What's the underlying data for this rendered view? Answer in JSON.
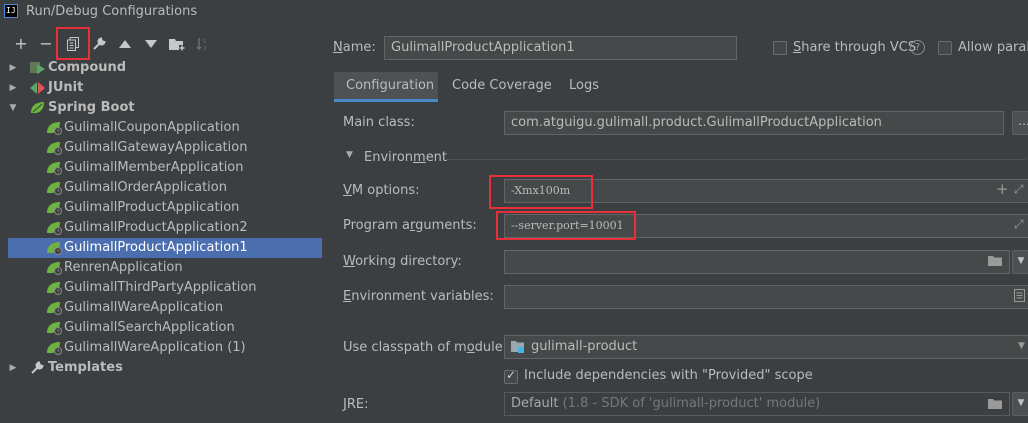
{
  "window": {
    "title": "Run/Debug Configurations",
    "app_icon": "IJ"
  },
  "toolbar": {
    "buttons": [
      "add-icon",
      "remove-icon",
      "copy-icon",
      "wrench-icon",
      "move-up-icon",
      "move-down-icon",
      "new-folder-icon",
      "sort-icon"
    ]
  },
  "tree": {
    "groups": {
      "compound": "Compound",
      "junit": "JUnit",
      "spring_boot": "Spring Boot",
      "templates": "Templates"
    },
    "items": [
      "GulimallCouponApplication",
      "GulimallGatewayApplication",
      "GulimallMemberApplication",
      "GulimallOrderApplication",
      "GulimallProductApplication",
      "GulimallProductApplication2",
      "GulimallProductApplication1",
      "RenrenApplication",
      "GulimallThirdPartyApplication",
      "GulimallWareApplication",
      "GulimallSearchApplication",
      "GulimallWareApplication (1)"
    ],
    "selected_index": 6
  },
  "form": {
    "name_label": "Name:",
    "name_value": "GulimallProductApplication1",
    "share_label": "Share through VCS",
    "share_checked": false,
    "allow_parallel_label": "Allow paral",
    "allow_parallel_checked": false,
    "tabs": [
      "Configuration",
      "Code Coverage",
      "Logs"
    ],
    "active_tab": "Configuration",
    "main_class_label": "Main class:",
    "main_class_value": "com.atguigu.gulimall.product.GulimallProductApplication",
    "browse_label": "...",
    "environment_label": "Environment",
    "vm_options_label": "VM options:",
    "vm_options_value": "-Xmx100m",
    "program_args_label": "Program arguments:",
    "program_args_value": "--server.port=10001",
    "working_dir_label": "Working directory:",
    "working_dir_value": "",
    "env_vars_label": "Environment variables:",
    "env_vars_value": "",
    "classpath_label": "Use classpath of module:",
    "classpath_value": "gulimall-product",
    "include_deps_label": "Include dependencies with \"Provided\" scope",
    "include_deps_checked": true,
    "jre_label": "JRE:",
    "jre_value": "Default",
    "jre_hint": "(1.8 - SDK of 'gulimall-product' module)"
  },
  "colors": {
    "background": "#3c3f41",
    "selection": "#4b6eaf",
    "highlight_box": "#e8303a",
    "tab_underline": "#4a88c7"
  }
}
